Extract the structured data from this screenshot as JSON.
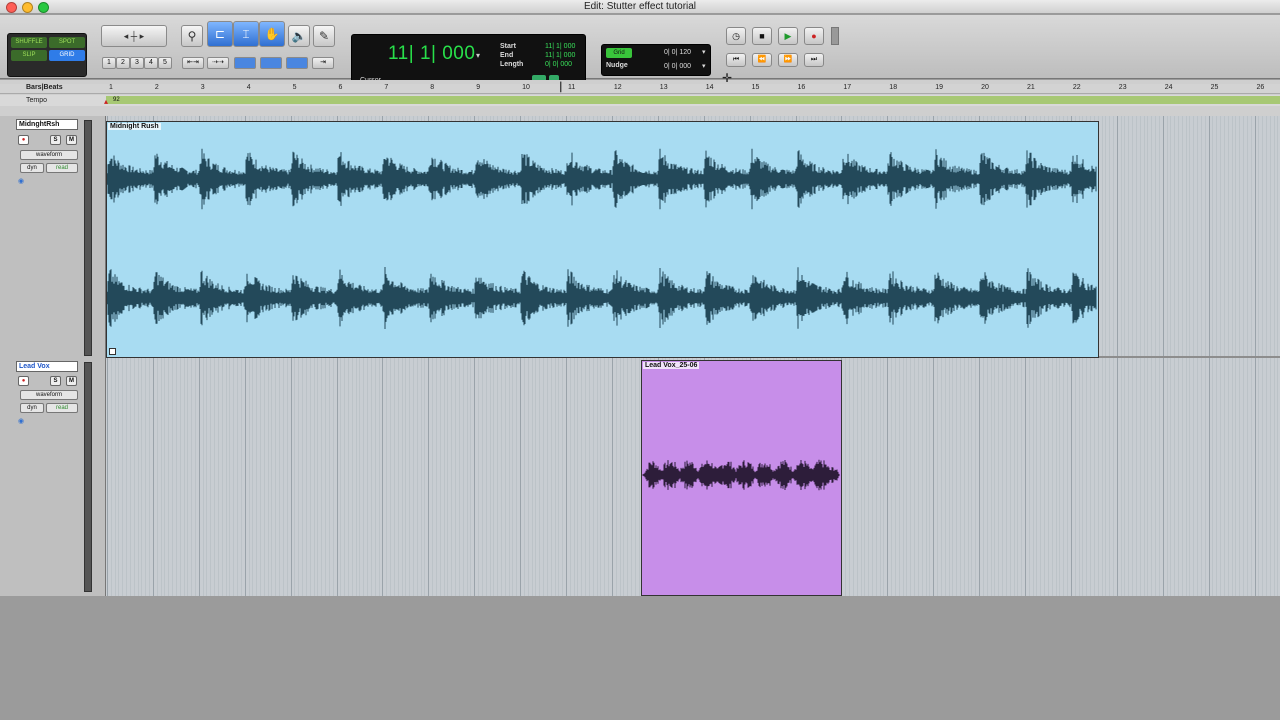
{
  "window": {
    "title": "Edit: Stutter effect tutorial"
  },
  "edit_modes": {
    "shuffle": "SHUFFLE",
    "spot": "SPOT",
    "slip": "SLIP",
    "grid": "GRID",
    "active": "GRID"
  },
  "zoom_presets": [
    "1",
    "2",
    "3",
    "4",
    "5"
  ],
  "counter": {
    "main": "11| 1| 000",
    "start_label": "Start",
    "end_label": "End",
    "length_label": "Length",
    "start": "11| 1| 000",
    "end": "11| 1| 000",
    "length": "0| 0| 000",
    "cursor_label": "Cursor"
  },
  "grid_nudge": {
    "grid_label": "Grid",
    "grid_value": "0| 0| 120",
    "nudge_label": "Nudge",
    "nudge_value": "0| 0| 000"
  },
  "ruler": {
    "bars_label": "Bars|Beats",
    "tempo_label": "Tempo",
    "tempo_value": "92",
    "bars": [
      "1",
      "2",
      "3",
      "4",
      "5",
      "6",
      "7",
      "8",
      "9",
      "10",
      "11",
      "12",
      "13",
      "14",
      "15",
      "16",
      "17",
      "18",
      "19",
      "20",
      "21",
      "22",
      "23",
      "24",
      "25",
      "26"
    ]
  },
  "tracks": [
    {
      "name": "MidnghtRsh",
      "view": "waveform",
      "automation_mode": "dyn",
      "automation_state": "read",
      "solo": "S",
      "mute": "M",
      "clip": {
        "name": "Midnight Rush",
        "color": "#a8dcf2",
        "wave_color": "#23495a"
      }
    },
    {
      "name": "Lead Vox",
      "view": "waveform",
      "automation_mode": "dyn",
      "automation_state": "read",
      "solo": "S",
      "mute": "M",
      "clip": {
        "name": "Lead Vox_25-06",
        "color": "#c78ee9",
        "wave_color": "#2d1d3a"
      }
    }
  ],
  "colors": {
    "counter_text": "#28e04a",
    "tempo_strip": "#a7c874",
    "selected_tool": "#2f6fd1",
    "record": "#cc2222",
    "play": "#1f9a2c"
  }
}
